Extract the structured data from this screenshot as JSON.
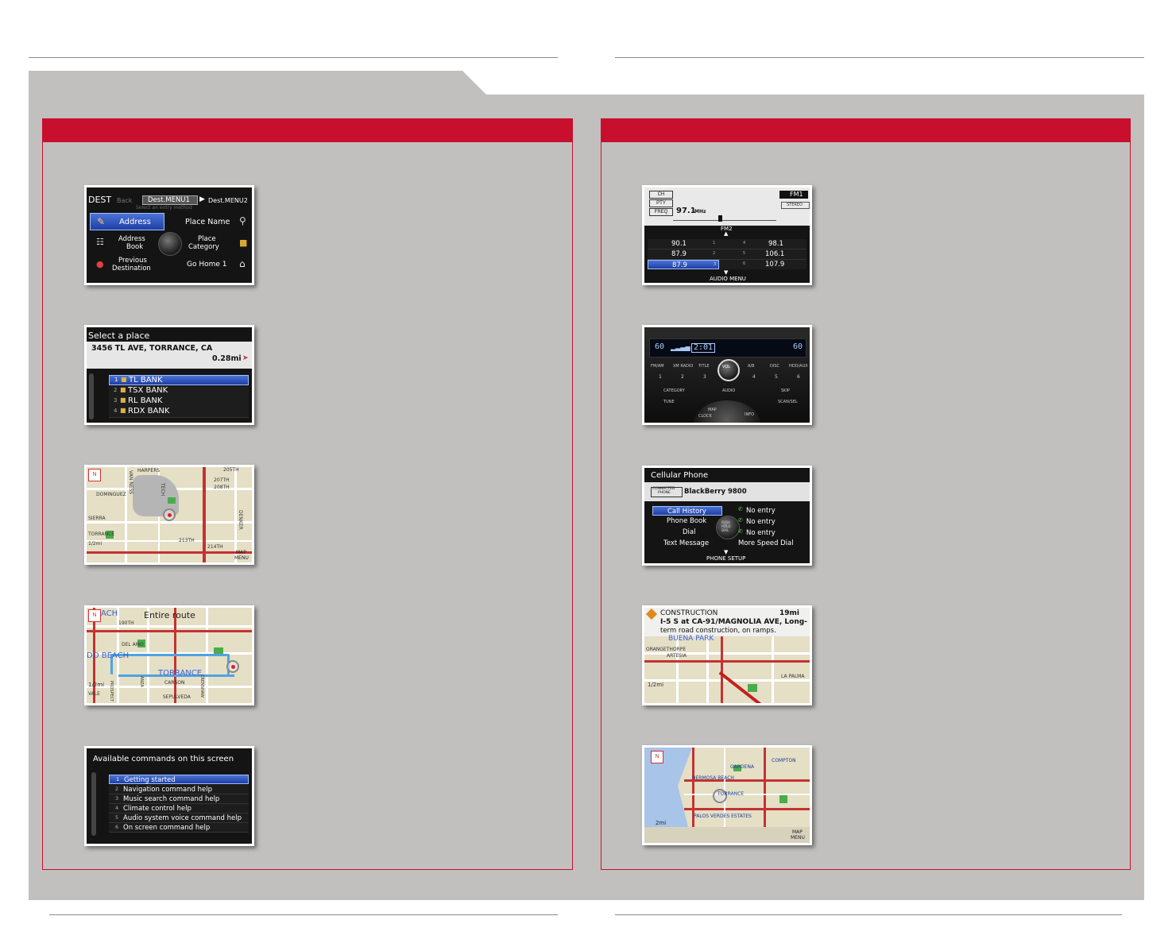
{
  "nav": {
    "dest_menu": {
      "title": "DEST",
      "tab_back": "Back",
      "tab_menu1": "Dest.MENU1",
      "tab_menu2": "Dest.MENU2",
      "subtitle": "Select an entry method",
      "items": {
        "address": "Address",
        "place_name": "Place Name",
        "address_book_1": "Address",
        "address_book_2": "Book",
        "place_category_1": "Place",
        "place_category_2": "Category",
        "previous_1": "Previous",
        "previous_2": "Destination",
        "go_home": "Go Home 1"
      }
    },
    "select_place": {
      "title": "Select a place",
      "address": "3456 TL AVE, TORRANCE, CA",
      "distance": "0.28mi",
      "items": [
        {
          "num": "1",
          "label": "TL BANK"
        },
        {
          "num": "2",
          "label": "TSX BANK"
        },
        {
          "num": "3",
          "label": "RL BANK"
        },
        {
          "num": "4",
          "label": "RDX BANK"
        }
      ]
    },
    "map1": {
      "labels": {
        "harpers": "HARPERS",
        "st205": "205TH",
        "st207": "207TH",
        "st208": "208TH",
        "dominguez": "DOMINGUEZ",
        "sierra": "SIERRA",
        "torrance": "TORRANCE",
        "van_ness": "VAN NESS",
        "tech": "TECH",
        "denker": "DENKER",
        "st214": "214TH",
        "st213": "213TH",
        "scale": "1/2mi",
        "map_menu_1": "MAP",
        "map_menu_2": "MENU"
      }
    },
    "route": {
      "title": "Entire route",
      "beach": "ACH",
      "st190": "190TH",
      "del_amo": "DEL AMO",
      "do_beach": "DO BEACH",
      "torrance": "TORRANCE",
      "carson": "CARSON",
      "sepulveda": "SEPULVEDA",
      "scale": "1/2mi",
      "prospect": "PROSPECT",
      "anza": "ANZA",
      "crenshaw": "CRENSHAW",
      "vale": "VALE"
    },
    "commands": {
      "title": "Available commands on this screen",
      "items": [
        {
          "num": "1",
          "label": "Getting started"
        },
        {
          "num": "2",
          "label": "Navigation command help"
        },
        {
          "num": "3",
          "label": "Music search command help"
        },
        {
          "num": "4",
          "label": "Climate control help"
        },
        {
          "num": "5",
          "label": "Audio system voice command help"
        },
        {
          "num": "6",
          "label": "On screen command help"
        }
      ]
    }
  },
  "audio": {
    "fm": {
      "btn_ch": "CH",
      "btn_pty": "PTY",
      "btn_freq": "FREQ",
      "freq": "97.1",
      "freq_unit": "MHz",
      "band": "FM1",
      "stereo": "STEREO",
      "fm2": "FM2",
      "presets_left": [
        "90.1",
        "87.9",
        "87.9"
      ],
      "presets_right": [
        "98.1",
        "106.1",
        "107.9"
      ],
      "preset_nums_left": [
        "1",
        "2",
        "3"
      ],
      "preset_nums_right": [
        "4",
        "5",
        "6"
      ],
      "footer": "AUDIO MENU"
    },
    "panel": {
      "display_left": "60",
      "display_time": "2:01",
      "display_right": "60",
      "btn_fmam": "FM/AM",
      "btn_xm": "XM RADIO",
      "btn_title": "TITLE",
      "btn_vol": "VOL",
      "btn_ab": "A/B",
      "btn_disc": "DISC",
      "btn_hdd": "HDD/AUX",
      "presets": [
        "1",
        "2",
        "3",
        "4",
        "5",
        "6"
      ],
      "btn_category": "CATEGORY",
      "btn_tune": "TUNE",
      "btn_audio": "AUDIO",
      "btn_skip": "SKIP",
      "btn_scan": "SCAN/SEL",
      "btn_clock": "CLOCK",
      "btn_info": "INFO",
      "btn_map": "MAP"
    },
    "phone": {
      "title": "Cellular Phone",
      "connected_1": "CONNECTED",
      "connected_2": "PHONE",
      "device": "BlackBerry 9800",
      "left_items": [
        "Call History",
        "Phone Book",
        "Dial",
        "Text Message"
      ],
      "right_items": [
        "No entry",
        "No entry",
        "No entry",
        "More Speed Dial"
      ],
      "knob_1": "PUSH",
      "knob_2": "HOLD",
      "knob_3": "DIAL",
      "footer": "PHONE SETUP"
    },
    "traffic": {
      "title": "CONSTRUCTION",
      "distance": "19mi",
      "line1": "I-5 S at CA-91/MAGNOLIA AVE, Long-",
      "line2": "term road construction, on ramps.",
      "buena_park": "BUENA PARK",
      "orangethorpe": "ORANGETHORPE",
      "artesia": "ARTESIA",
      "la_palma": "LA PALMA",
      "scale": "1/2mi"
    },
    "weather": {
      "gardena": "GARDENA",
      "compton": "COMPTON",
      "hermosa": "HERMOSA BEACH",
      "torrance": "TORRANCE",
      "palos": "PALOS VERDES ESTATES",
      "scale": "2mi",
      "map_menu_1": "MAP",
      "map_menu_2": "MENU"
    }
  }
}
